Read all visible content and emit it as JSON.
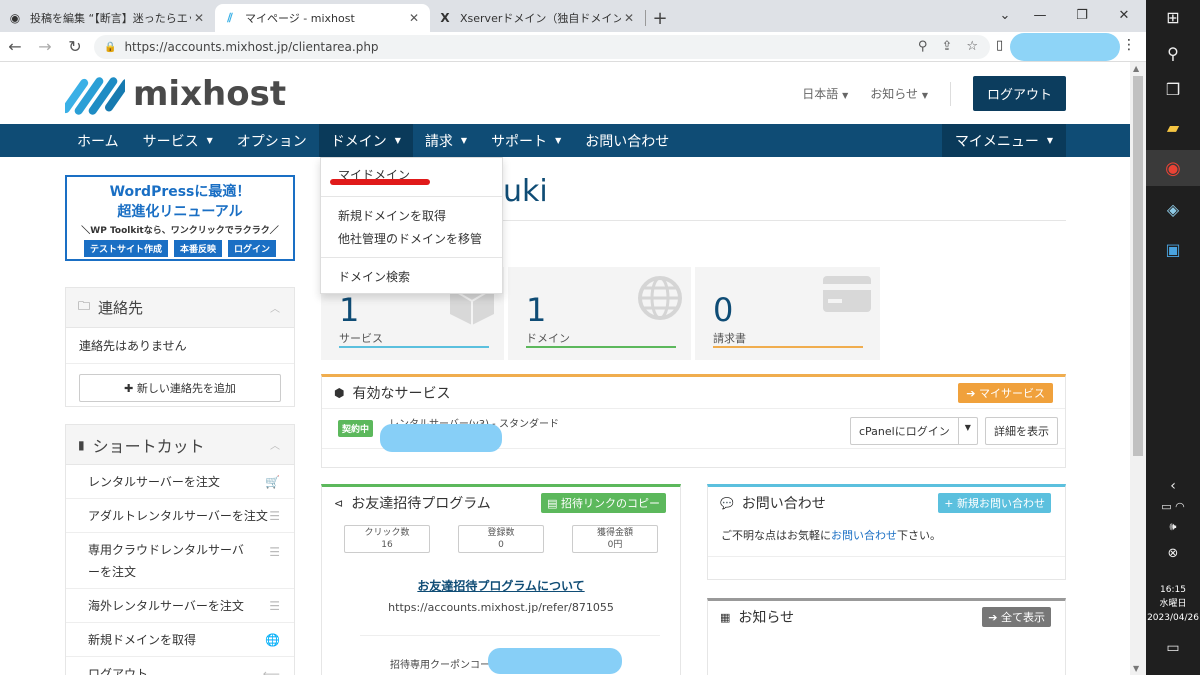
{
  "browser": {
    "tabs": [
      {
        "title": "投稿を編集 “【断言】迷ったらエックス",
        "icon": "wordpress-icon",
        "active": false
      },
      {
        "title": "マイページ - mixhost",
        "icon": "mixhost-icon",
        "active": true
      },
      {
        "title": "Xserverドメイン（独自ドメイン）移管",
        "icon": "xserver-icon",
        "active": false
      }
    ],
    "url": "https://accounts.mixhost.jp/clientarea.php"
  },
  "site": {
    "logo_text": "mixhost",
    "language": "日本語",
    "notice": "お知らせ",
    "logout": "ログアウト",
    "nav": [
      {
        "label": "ホーム",
        "caret": false
      },
      {
        "label": "サービス",
        "caret": true
      },
      {
        "label": "オプション",
        "caret": false
      },
      {
        "label": "ドメイン",
        "caret": true
      },
      {
        "label": "請求",
        "caret": true
      },
      {
        "label": "サポート",
        "caret": true
      },
      {
        "label": "お問い合わせ",
        "caret": false
      }
    ],
    "mymenu": "マイメニュー",
    "domain_dropdown": {
      "items": [
        "マイドメイン",
        "新規ドメインを取得",
        "他社管理のドメインを移管",
        "ドメイン検索"
      ]
    },
    "banner": {
      "line1": "WordPressに最適！",
      "line2": "超進化リニューアル",
      "line3": "＼WP Toolkitなら、ワンクリックでラクラク／",
      "buttons": [
        "テストサイト作成",
        "本番反映",
        "ログイン"
      ]
    },
    "contacts": {
      "title": "連絡先",
      "empty": "連絡先はありません",
      "add": "新しい連絡先を追加"
    },
    "shortcuts": {
      "title": "ショートカット",
      "items": [
        "レンタルサーバーを注文",
        "アダルトレンタルサーバーを注文",
        "専用クラウドレンタルサーバーを注文",
        "海外レンタルサーバーを注文",
        "新規ドメインを取得",
        "ログアウト"
      ]
    },
    "username": "uki",
    "stats": [
      {
        "value": "1",
        "label": "サービス",
        "color": "#5bc0de"
      },
      {
        "value": "1",
        "label": "ドメイン",
        "color": "#5cb85c"
      },
      {
        "value": "0",
        "label": "請求書",
        "color": "#f0ad4e"
      }
    ],
    "services": {
      "title": "有効なサービス",
      "my_services": "マイサービス",
      "status": "契約中",
      "product": "レンタルサーバー(v3) - スタンダード",
      "cpanel": "cPanelにログイン",
      "details": "詳細を表示"
    },
    "referral": {
      "title": "お友達招待プログラム",
      "copy": "招待リンクのコピー",
      "stats": [
        {
          "label": "クリック数",
          "value": "16"
        },
        {
          "label": "登録数",
          "value": "0"
        },
        {
          "label": "獲得金額",
          "value": "0円"
        }
      ],
      "about": "お友達招待プログラムについて",
      "link": "https://accounts.mixhost.jp/refer/871055",
      "coupon_label": "招待専用クーポンコー"
    },
    "inquiry": {
      "title": "お問い合わせ",
      "new": "新規お問い合わせ",
      "text_before": "ご不明な点はお気軽に",
      "link": "お問い合わせ",
      "text_after": "下さい。"
    },
    "news": {
      "title": "お知らせ",
      "view_all": "全て表示"
    }
  },
  "taskbar": {
    "time": "16:15",
    "weekday": "水曜日",
    "date": "2023/04/26"
  }
}
